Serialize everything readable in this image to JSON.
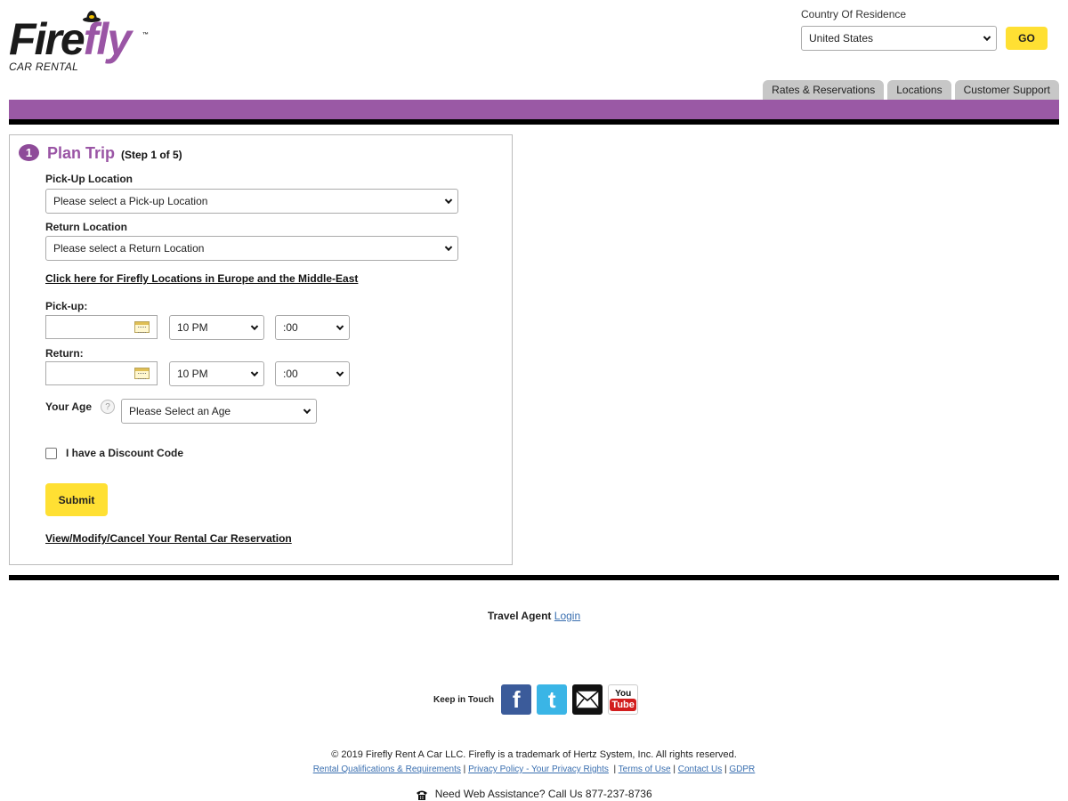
{
  "header": {
    "logo_fire": "Fire",
    "logo_fly": "fly",
    "logo_tm": "™",
    "logo_sub": "CAR RENTAL",
    "country_label": "Country Of Residence",
    "country_value": "United States",
    "go_label": "GO"
  },
  "nav": {
    "tabs": [
      "Rates & Reservations",
      "Locations",
      "Customer Support"
    ]
  },
  "plan": {
    "step_number": "1",
    "title": "Plan Trip",
    "step_text": "(Step 1 of 5)",
    "pickup_location_label": "Pick-Up Location",
    "pickup_location_value": "Please select a Pick-up Location",
    "return_location_label": "Return Location",
    "return_location_value": "Please select a Return Location",
    "europe_link": "Click here for Firefly Locations in Europe and the Middle-East",
    "pickup_label": "Pick-up:",
    "pickup_hour": "10 PM",
    "pickup_minute": ":00",
    "return_label": "Return:",
    "return_hour": "10 PM",
    "return_minute": ":00",
    "age_label": "Your Age",
    "age_help": "?",
    "age_value": "Please Select an Age",
    "discount_label": "I have a Discount Code",
    "submit_label": "Submit",
    "view_modify_link": "View/Modify/Cancel Your Rental Car Reservation"
  },
  "footer": {
    "travel_agent": "Travel Agent",
    "login": "Login",
    "keep_in_touch": "Keep in Touch",
    "social_icons": [
      "facebook-icon",
      "twitter-icon",
      "email-icon",
      "youtube-icon"
    ],
    "fb_glyph": "f",
    "tw_glyph": "t",
    "yt_you": "You",
    "yt_tube": "Tube",
    "copyright": "© 2019 Firefly Rent A Car LLC. Firefly is a trademark of Hertz System, Inc. All rights reserved.",
    "links": [
      "Rental Qualifications & Requirements",
      "Privacy Policy - Your Privacy Rights",
      "Terms of Use",
      "Contact Us",
      "GDPR"
    ],
    "assistance": "Need Web Assistance? Call Us 877-237-8736"
  },
  "colors": {
    "brand_purple": "#9a59a5",
    "accent_yellow": "#ffe033",
    "link_blue": "#3a6fb0"
  }
}
